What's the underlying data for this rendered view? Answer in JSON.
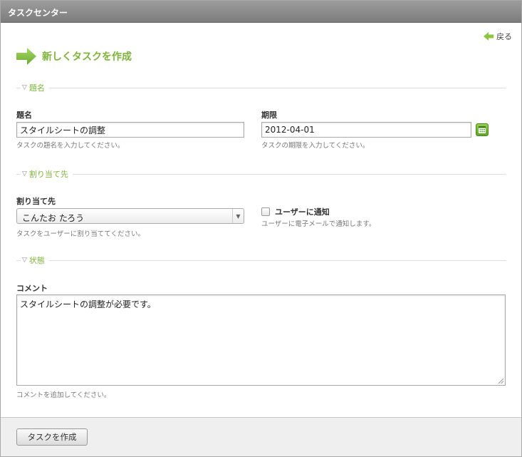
{
  "window": {
    "title": "タスクセンター"
  },
  "nav": {
    "back_label": "戻る"
  },
  "page": {
    "heading": "新しくタスクを作成"
  },
  "sections": {
    "title_section": "題名",
    "assign_section": "割り当て先",
    "status_section": "状態"
  },
  "fields": {
    "title": {
      "label": "題名",
      "value": "スタイルシートの調整",
      "hint": "タスクの題名を入力してください。"
    },
    "due": {
      "label": "期限",
      "value": "2012-04-01",
      "hint": "タスクの期限を入力してください。"
    },
    "assignee": {
      "label": "割り当て先",
      "selected": "こんたお たろう",
      "hint": "タスクをユーザーに割り当ててください。"
    },
    "notify": {
      "label": "ユーザーに通知",
      "checked": false,
      "hint": "ユーザーに電子メールで通知します。"
    },
    "comment": {
      "label": "コメント",
      "value": "スタイルシートの調整が必要です。",
      "hint": "コメントを追加してください。"
    }
  },
  "footer": {
    "submit_label": "タスクを作成"
  },
  "colors": {
    "accent": "#7db33a",
    "titlebar": "#8a8a8a"
  },
  "icons": {
    "back": "left-arrow-icon",
    "heading": "right-arrow-icon",
    "collapse": "triangle-down-icon",
    "calendar": "calendar-icon",
    "dropdown": "chevron-down-icon"
  }
}
